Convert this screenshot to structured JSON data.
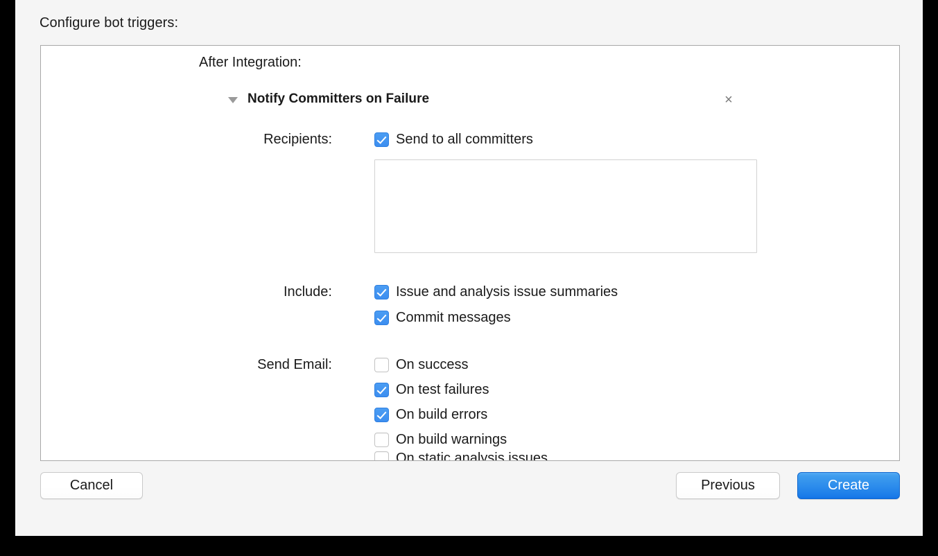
{
  "sheet": {
    "prompt_label": "Configure bot triggers:"
  },
  "panel": {
    "section_title": "After Integration:",
    "trigger": {
      "disclosure_state": "expanded",
      "disclosure_icon": "triangle-down-icon",
      "title": "Notify Committers on Failure",
      "close_icon": "close-x-icon",
      "close_label": "×"
    },
    "fields": {
      "recipients": {
        "label": "Recipients:",
        "checkbox": {
          "label": "Send to all committers",
          "checked": true
        },
        "textarea": {
          "value": "",
          "placeholder": ""
        }
      },
      "include": {
        "label": "Include:",
        "options": [
          {
            "label": "Issue and analysis issue summaries",
            "checked": true
          },
          {
            "label": "Commit messages",
            "checked": true
          }
        ]
      },
      "send_email": {
        "label": "Send Email:",
        "options": [
          {
            "label": "On success",
            "checked": false
          },
          {
            "label": "On test failures",
            "checked": true
          },
          {
            "label": "On build errors",
            "checked": true
          },
          {
            "label": "On build warnings",
            "checked": false
          },
          {
            "label": "On static analysis issues",
            "checked": false
          }
        ]
      }
    }
  },
  "footer": {
    "cancel_label": "Cancel",
    "previous_label": "Previous",
    "create_label": "Create"
  },
  "colors": {
    "accent_blue": "#3c8ef0",
    "primary_button_top": "#3f9dee",
    "primary_button_bottom": "#1273e6",
    "sheet_background": "#f5f5f5",
    "panel_border": "#a8a8a8",
    "text": "#1a1a1a",
    "muted": "#7a7a7a"
  }
}
